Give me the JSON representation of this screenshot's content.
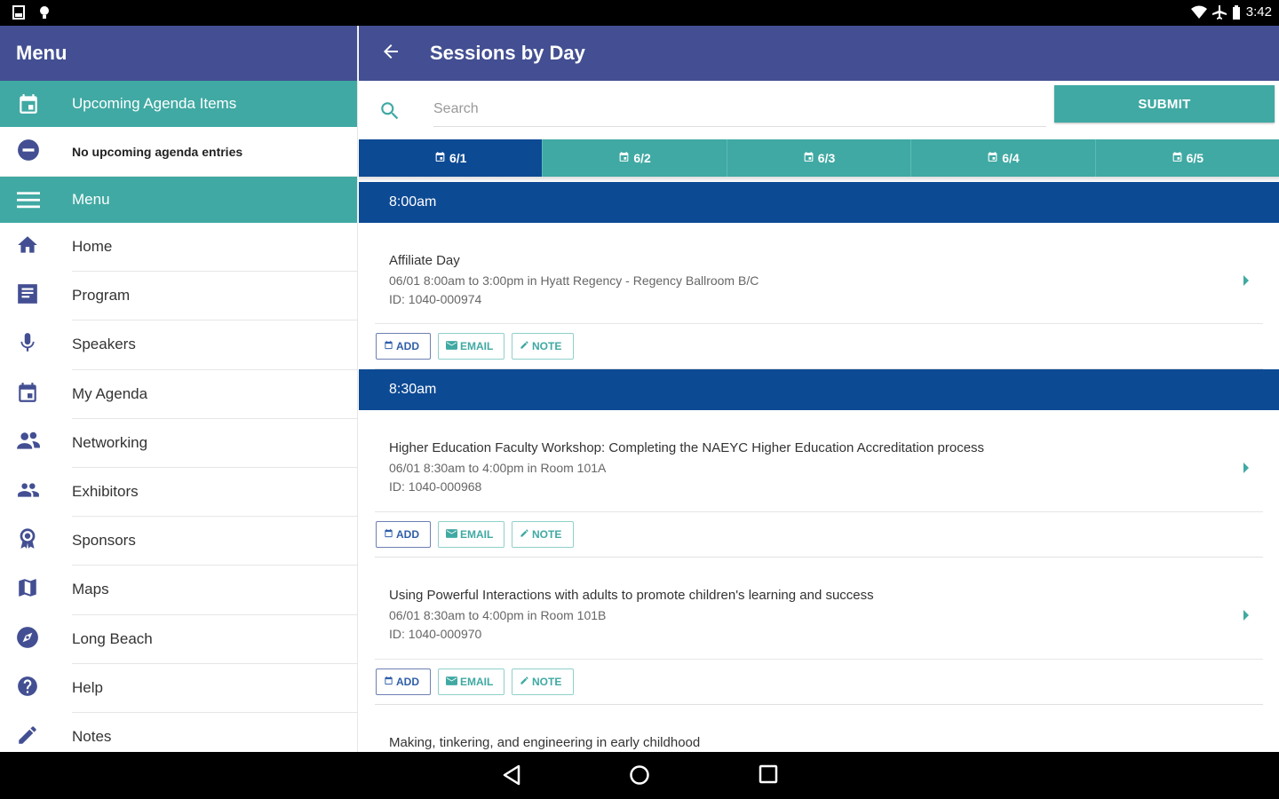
{
  "status_bar": {
    "time": "3:42"
  },
  "drawer": {
    "title": "Menu",
    "upcoming": {
      "label": "Upcoming Agenda Items",
      "empty_text": "No upcoming agenda entries"
    },
    "menu_header": "Menu",
    "items": [
      {
        "label": "Home",
        "icon": "home-icon"
      },
      {
        "label": "Program",
        "icon": "program-icon"
      },
      {
        "label": "Speakers",
        "icon": "microphone-icon"
      },
      {
        "label": "My Agenda",
        "icon": "calendar-icon"
      },
      {
        "label": "Networking",
        "icon": "networking-icon"
      },
      {
        "label": "Exhibitors",
        "icon": "people-icon"
      },
      {
        "label": "Sponsors",
        "icon": "award-icon"
      },
      {
        "label": "Maps",
        "icon": "map-icon"
      },
      {
        "label": "Long Beach",
        "icon": "compass-icon"
      },
      {
        "label": "Help",
        "icon": "help-icon"
      },
      {
        "label": "Notes",
        "icon": "pencil-icon"
      }
    ]
  },
  "main": {
    "title": "Sessions by Day",
    "search": {
      "placeholder": "Search",
      "submit_label": "SUBMIT"
    },
    "tabs": [
      {
        "label": "6/1",
        "active": true
      },
      {
        "label": "6/2",
        "active": false
      },
      {
        "label": "6/3",
        "active": false
      },
      {
        "label": "6/4",
        "active": false
      },
      {
        "label": "6/5",
        "active": false
      }
    ],
    "action_labels": {
      "add": "ADD",
      "email": "EMAIL",
      "note": "NOTE"
    },
    "groups": [
      {
        "time": "8:00am",
        "sessions": [
          {
            "title": "Affiliate Day",
            "when": "06/01 8:00am to 3:00pm in Hyatt Regency - Regency Ballroom B/C",
            "id": "ID: 1040-000974"
          }
        ]
      },
      {
        "time": "8:30am",
        "sessions": [
          {
            "title": "Higher Education Faculty Workshop: Completing the NAEYC Higher Education Accreditation process",
            "when": "06/01 8:30am to 4:00pm in Room 101A",
            "id": "ID: 1040-000968"
          },
          {
            "title": "Using Powerful Interactions with adults to promote children's learning and success",
            "when": "06/01 8:30am to 4:00pm in Room 101B",
            "id": "ID: 1040-000970"
          },
          {
            "title": "Making, tinkering, and engineering in early childhood",
            "when": "",
            "id": ""
          }
        ]
      }
    ]
  },
  "colors": {
    "primary": "#434f92",
    "accent": "#40a9a3",
    "dark_blue": "#0d4a94"
  }
}
